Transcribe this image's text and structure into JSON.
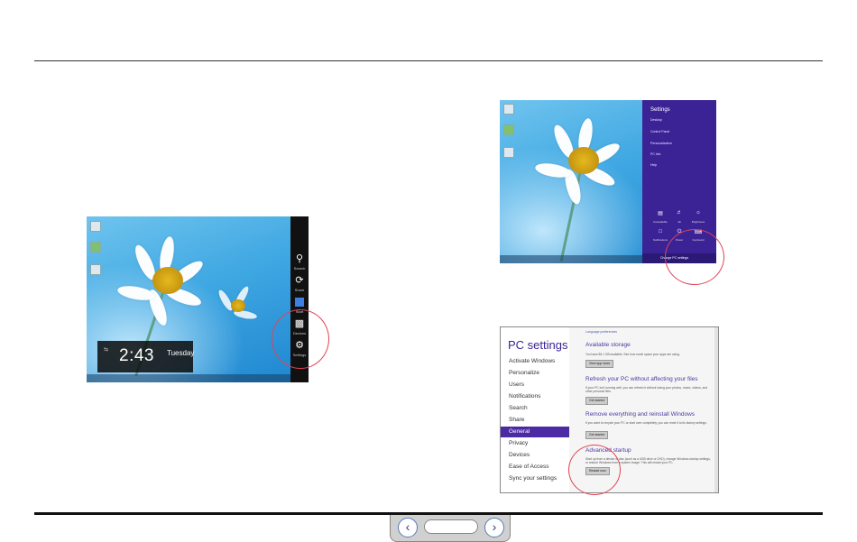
{
  "slide": {
    "nav": {
      "prev_icon": "chevron-left-icon",
      "next_icon": "chevron-right-icon"
    }
  },
  "screenshot1": {
    "charms": [
      {
        "label": "Search",
        "icon": "search-icon"
      },
      {
        "label": "Share",
        "icon": "share-icon"
      },
      {
        "label": "Start",
        "icon": "windows-icon"
      },
      {
        "label": "Devices",
        "icon": "devices-icon"
      },
      {
        "label": "Settings",
        "icon": "gear-icon"
      }
    ],
    "clock": {
      "time": "2:43",
      "day": "Tuesday"
    }
  },
  "screenshot2": {
    "settings": {
      "title": "Settings",
      "items": [
        "Desktop",
        "Control Panel",
        "Personalization",
        "PC info",
        "Help"
      ],
      "tiles": [
        {
          "label": "Unavailable",
          "icon": "network-icon"
        },
        {
          "label": "40",
          "icon": "volume-icon"
        },
        {
          "label": "Brightness",
          "icon": "brightness-icon"
        },
        {
          "label": "Notifications",
          "icon": "notifications-icon"
        },
        {
          "label": "Power",
          "icon": "power-icon"
        },
        {
          "label": "Keyboard",
          "icon": "keyboard-icon"
        }
      ],
      "change_pc_settings": "Change PC settings"
    }
  },
  "screenshot3": {
    "title": "PC settings",
    "nav": [
      "Activate Windows",
      "Personalize",
      "Users",
      "Notifications",
      "Search",
      "Share",
      "General",
      "Privacy",
      "Devices",
      "Ease of Access",
      "Sync your settings"
    ],
    "selected": "General",
    "sections": {
      "link": "Language preferences",
      "storage_title": "Available storage",
      "storage_desc": "You have 86.1 GB available. See how much space your apps are using.",
      "storage_btn": "View app sizes",
      "refresh_title": "Refresh your PC without affecting your files",
      "refresh_desc": "If your PC isn't running well, you can refresh it without losing your photos, music, videos, and other personal files.",
      "refresh_btn": "Get started",
      "remove_title": "Remove everything and reinstall Windows",
      "remove_desc": "If you want to recycle your PC or start over completely, you can reset it to its factory settings.",
      "remove_btn": "Get started",
      "advanced_title": "Advanced startup",
      "advanced_desc": "Start up from a device or disc (such as a USB drive or DVD), change Windows startup settings, or restore Windows from a system image. This will restart your PC.",
      "advanced_btn": "Restart now"
    }
  }
}
